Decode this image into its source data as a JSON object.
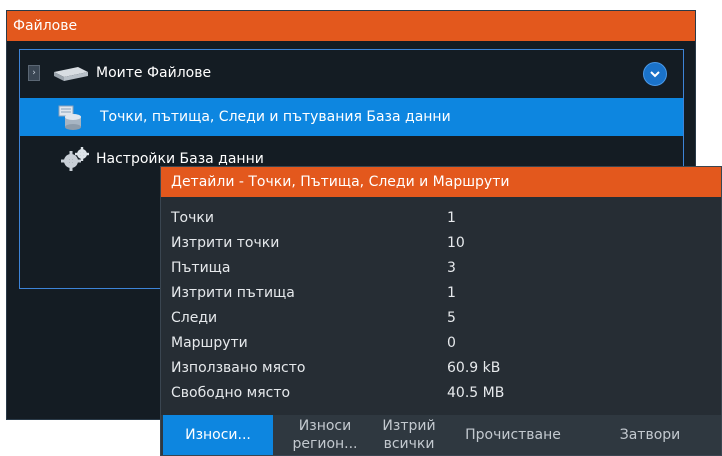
{
  "files_window": {
    "title": "Файлове",
    "items": [
      {
        "label": "Моите Файлове",
        "icon": "drive-icon"
      },
      {
        "label": "Точки, пътища,  Следи и пътувания База данни",
        "icon": "database-icon"
      },
      {
        "label": "Настройки  База данни",
        "icon": "gears-icon"
      }
    ]
  },
  "details": {
    "title": "Детайли - Точки, Пътища, Следи и Маршрути",
    "rows": [
      {
        "label": "Точки",
        "value": "1"
      },
      {
        "label": "Изтрити точки",
        "value": "10"
      },
      {
        "label": "Пътища",
        "value": "3"
      },
      {
        "label": "Изтрити пътища",
        "value": "1"
      },
      {
        "label": "Следи",
        "value": "5"
      },
      {
        "label": "Маршрути",
        "value": "0"
      },
      {
        "label": "Използвано място",
        "value": "60.9 kB"
      },
      {
        "label": "Свободно място",
        "value": "40.5 MB"
      }
    ]
  },
  "toolbar": {
    "export": "Износи...",
    "export_region_line1": "Износи",
    "export_region_line2": "регион...",
    "delete_all_line1": "Изтрий",
    "delete_all_line2": "всички",
    "clean": "Прочистване",
    "close": "Затвори"
  },
  "colors": {
    "title_bar": "#e3581d",
    "selection": "#0d86e0",
    "panel_dark": "#141c23",
    "details_bg": "#262d34"
  }
}
